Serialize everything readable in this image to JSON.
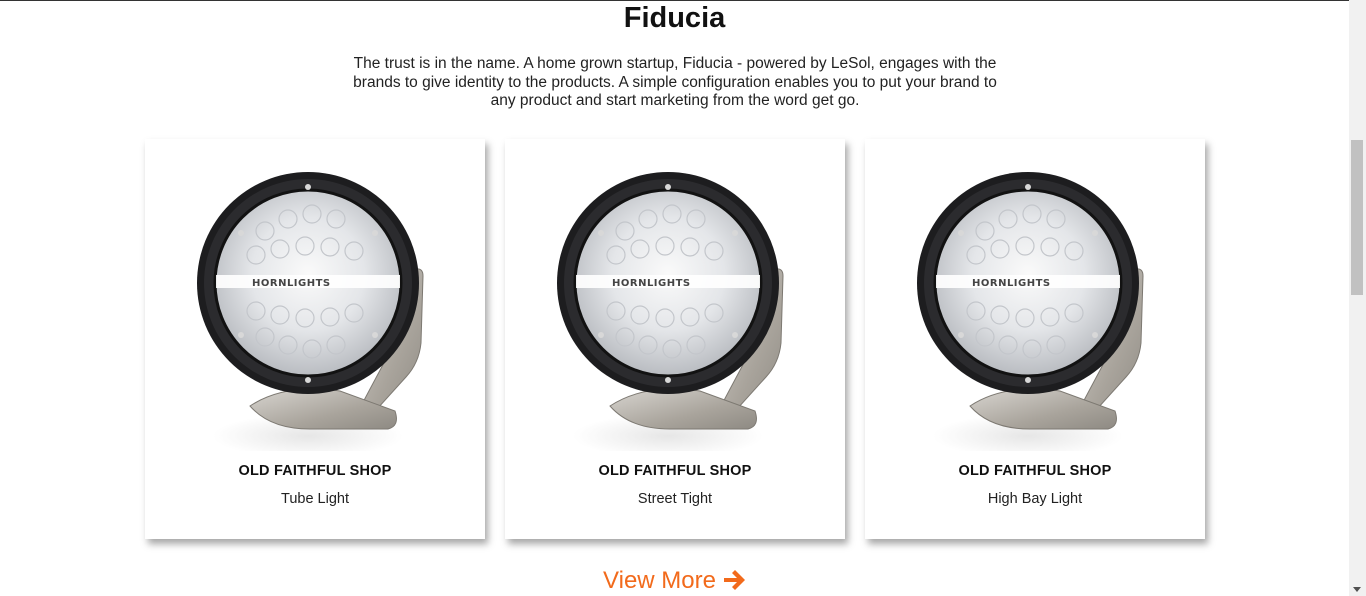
{
  "section": {
    "title": "Fiducia",
    "intro": "The trust is in the name. A home grown startup, Fiducia - powered by LeSol, engages with the brands to give identity to the products. A simple configuration enables you to put your brand to any product and start marketing from the word get go."
  },
  "products": [
    {
      "shop": "OLD FAITHFUL SHOP",
      "name": "Tube Light",
      "image_icon": "round-led-light-image"
    },
    {
      "shop": "OLD FAITHFUL SHOP",
      "name": "Street Tight",
      "image_icon": "round-led-light-image"
    },
    {
      "shop": "OLD FAITHFUL SHOP",
      "name": "High Bay Light",
      "image_icon": "round-led-light-image"
    }
  ],
  "view_more": {
    "label": "View More",
    "icon": "arrow-right-icon"
  },
  "colors": {
    "accent": "#f26a1b",
    "text": "#111111",
    "background": "#ffffff"
  }
}
